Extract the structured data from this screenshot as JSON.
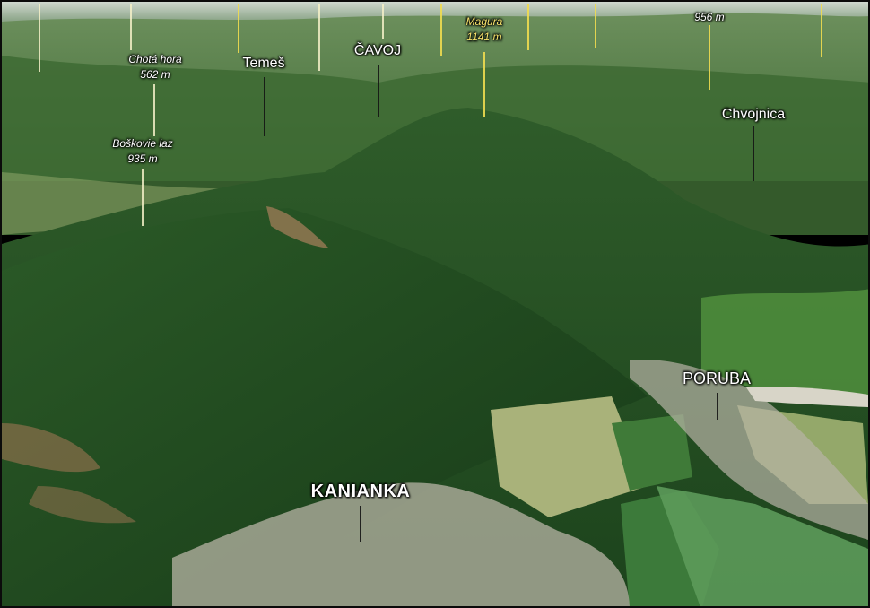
{
  "map": {
    "towns": [
      {
        "name": "KANIANKA"
      },
      {
        "name": "PORUBA"
      }
    ],
    "features": [
      {
        "name": "Temeš"
      },
      {
        "name": "ČAVOJ"
      },
      {
        "name": "Chvojnica"
      }
    ],
    "peaks": [
      {
        "name": "Chotá hora",
        "elevation": "562 m"
      },
      {
        "name": "Boškovie laz",
        "elevation": "935 m"
      },
      {
        "name": "Magura",
        "elevation": "1141 m"
      },
      {
        "name": "",
        "elevation": "956 m"
      }
    ]
  },
  "colors": {
    "forest_dark": "#1f4a1f",
    "forest_mid": "#2e5f2a",
    "field_light": "#a9b27a",
    "meadow": "#4e8c3c",
    "settlement": "#b8b4a6",
    "label_yellow": "#f7e26b"
  }
}
